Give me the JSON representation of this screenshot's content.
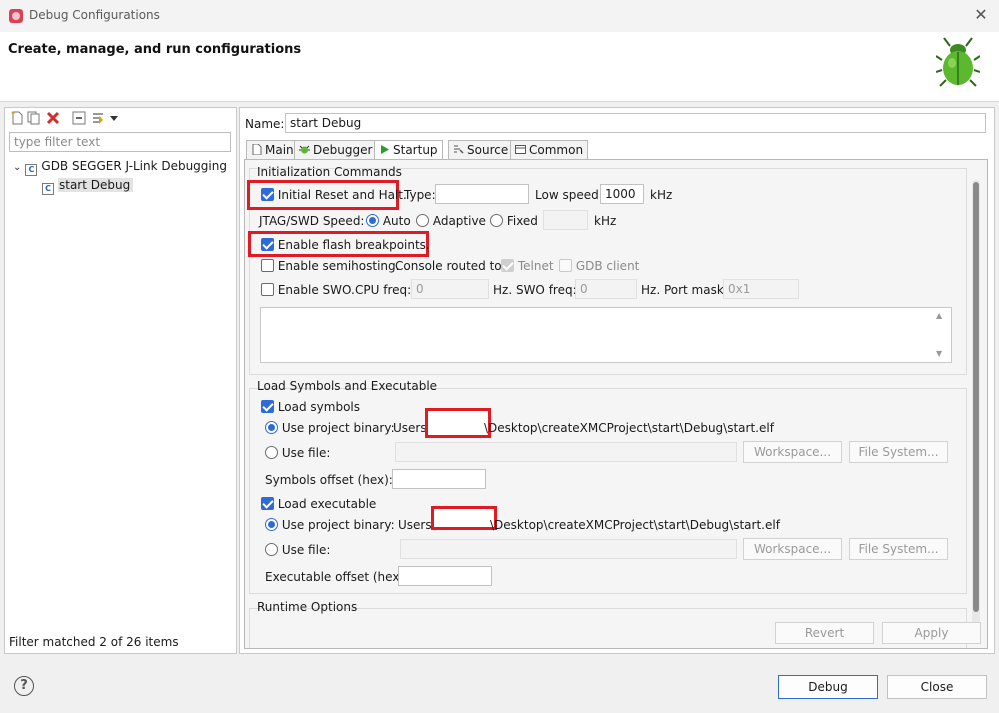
{
  "window": {
    "title": "Debug Configurations",
    "close_glyph": "✕"
  },
  "header": {
    "heading": "Create, manage, and run configurations",
    "icon": "bug-icon"
  },
  "left": {
    "filter_placeholder": "type filter text",
    "tree": [
      {
        "label": "GDB SEGGER J-Link Debugging",
        "expanded": true
      },
      {
        "label": "start Debug",
        "selected": true
      }
    ],
    "status": "Filter matched 2 of 26 items"
  },
  "right": {
    "name_label": "Name:",
    "name_value": "start Debug",
    "tabs": [
      "Main",
      "Debugger",
      "Startup",
      "Source",
      "Common"
    ],
    "active_tab": "Startup",
    "init": {
      "title": "Initialization Commands",
      "initial_reset": "Initial Reset and Halt.",
      "type_label": "Type:",
      "type_value": "",
      "low_speed_label": "Low speed:",
      "low_speed_value": "1000",
      "khz1": "kHz",
      "jtag_label": "JTAG/SWD Speed:",
      "auto": "Auto",
      "adaptive": "Adaptive",
      "fixed": "Fixed",
      "khz2": "kHz",
      "flash_bp": "Enable flash breakpoints.",
      "semihosting": "Enable semihosting.",
      "console_label": "Console routed to:",
      "telnet": "Telnet",
      "gdb_client": "GDB client",
      "swo": "Enable SWO.",
      "cpu_freq_label": "CPU freq:",
      "cpu_freq_value": "0",
      "swo_freq_label": "Hz. SWO freq:",
      "swo_freq_value": "0",
      "port_mask_label": "Hz. Port mask:",
      "port_mask_value": "0x1"
    },
    "load": {
      "title": "Load Symbols and Executable",
      "load_symbols": "Load symbols",
      "use_project_binary": "Use project binary:",
      "symbols_path_prefix": "Users\\",
      "symbols_path_suffix": "\\Desktop\\createXMCProject\\start\\Debug\\start.elf",
      "use_file": "Use file:",
      "workspace": "Workspace...",
      "file_system": "File System...",
      "symbols_offset": "Symbols offset (hex):",
      "load_executable": "Load executable",
      "exec_use_project_binary": "Use project binary:",
      "exec_path_prefix": "Users\\",
      "exec_path_suffix": "\\Desktop\\createXMCProject\\start\\Debug\\start.elf",
      "exec_use_file": "Use file:",
      "exec_workspace": "Workspace...",
      "exec_file_system": "File System...",
      "exec_offset": "Executable offset (hex):"
    },
    "runtime_title": "Runtime Options",
    "revert": "Revert",
    "apply": "Apply"
  },
  "footer": {
    "help_glyph": "?",
    "debug": "Debug",
    "close": "Close"
  },
  "colors": {
    "accent": "#2f6bd6",
    "highlight": "#e01b24"
  }
}
